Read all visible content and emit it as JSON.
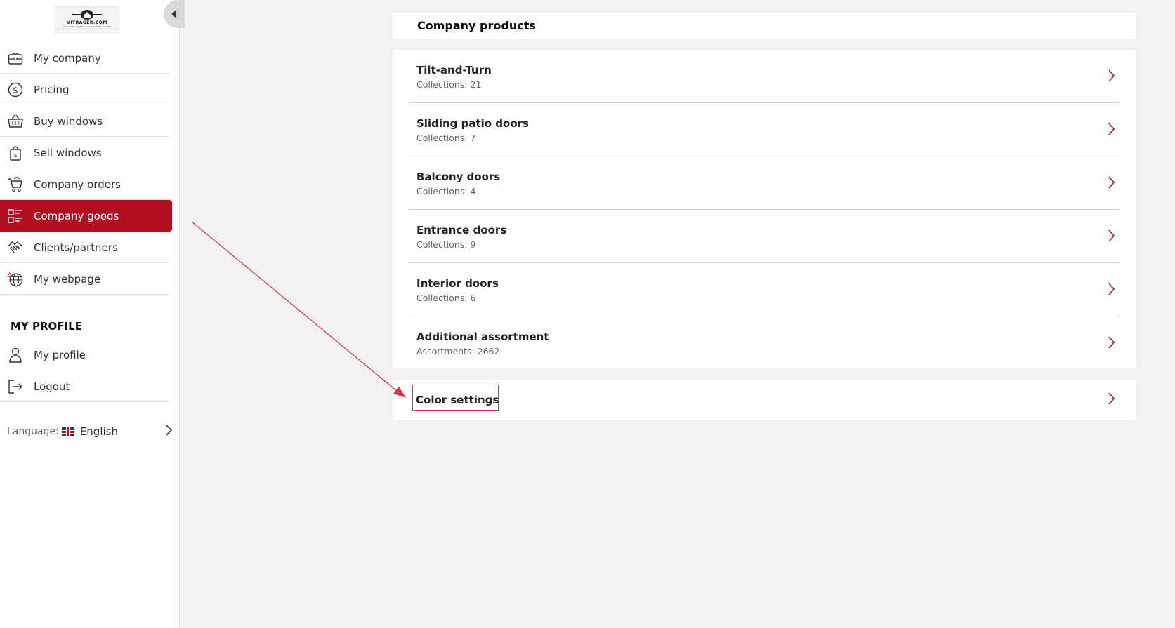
{
  "brand": {
    "logo_text": "VITRAGER.COM",
    "logo_subtext": "WINDOWS DOORS AND FACADES ONLINE"
  },
  "sidebar": {
    "items": [
      {
        "label": "My company",
        "icon": "briefcase-icon"
      },
      {
        "label": "Pricing",
        "icon": "dollar-circle-icon"
      },
      {
        "label": "Buy windows",
        "icon": "basket-icon"
      },
      {
        "label": "Sell windows",
        "icon": "shopping-bag-icon"
      },
      {
        "label": "Company orders",
        "icon": "cart-icon"
      },
      {
        "label": "Company goods",
        "icon": "list-grid-icon",
        "active": true
      },
      {
        "label": "Clients/partners",
        "icon": "handshake-icon"
      },
      {
        "label": "My webpage",
        "icon": "globe-icon"
      }
    ],
    "profile_section_title": "MY PROFILE",
    "profile_items": [
      {
        "label": "My profile",
        "icon": "user-icon"
      },
      {
        "label": "Logout",
        "icon": "logout-icon"
      }
    ],
    "language": {
      "label": "Language:",
      "value": "English",
      "flag": "uk-flag-icon"
    }
  },
  "main": {
    "title": "Company products",
    "products": [
      {
        "name": "Tilt-and-Turn",
        "meta": "Collections: 21"
      },
      {
        "name": "Sliding patio doors",
        "meta": "Collections: 7"
      },
      {
        "name": "Balcony doors",
        "meta": "Collections: 4"
      },
      {
        "name": "Entrance doors",
        "meta": "Collections: 9"
      },
      {
        "name": "Interior doors",
        "meta": "Collections: 6"
      },
      {
        "name": "Additional assortment",
        "meta": "Assortments: 2662"
      }
    ],
    "color_settings": {
      "label": "Color settings"
    }
  },
  "colors": {
    "accent": "#b30f23",
    "annotation": "#e0303a",
    "background": "#f2f2f2"
  }
}
